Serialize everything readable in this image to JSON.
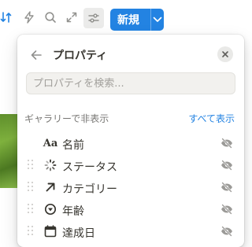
{
  "toolbar": {
    "new_button_label": "新規"
  },
  "panel": {
    "title": "プロパティ",
    "search_placeholder": "プロパティを検索...",
    "section_label": "ギャラリーで非表示",
    "show_all_label": "すべて表示",
    "properties": [
      {
        "label": "名前",
        "icon": "text-aa-icon"
      },
      {
        "label": "ステータス",
        "icon": "status-loader-icon"
      },
      {
        "label": "カテゴリー",
        "icon": "arrow-up-right-icon"
      },
      {
        "label": "年齢",
        "icon": "select-circle-icon"
      },
      {
        "label": "達成日",
        "icon": "calendar-icon"
      }
    ]
  },
  "colors": {
    "accent": "#2383e2",
    "text": "#37352f",
    "muted": "#787774"
  }
}
